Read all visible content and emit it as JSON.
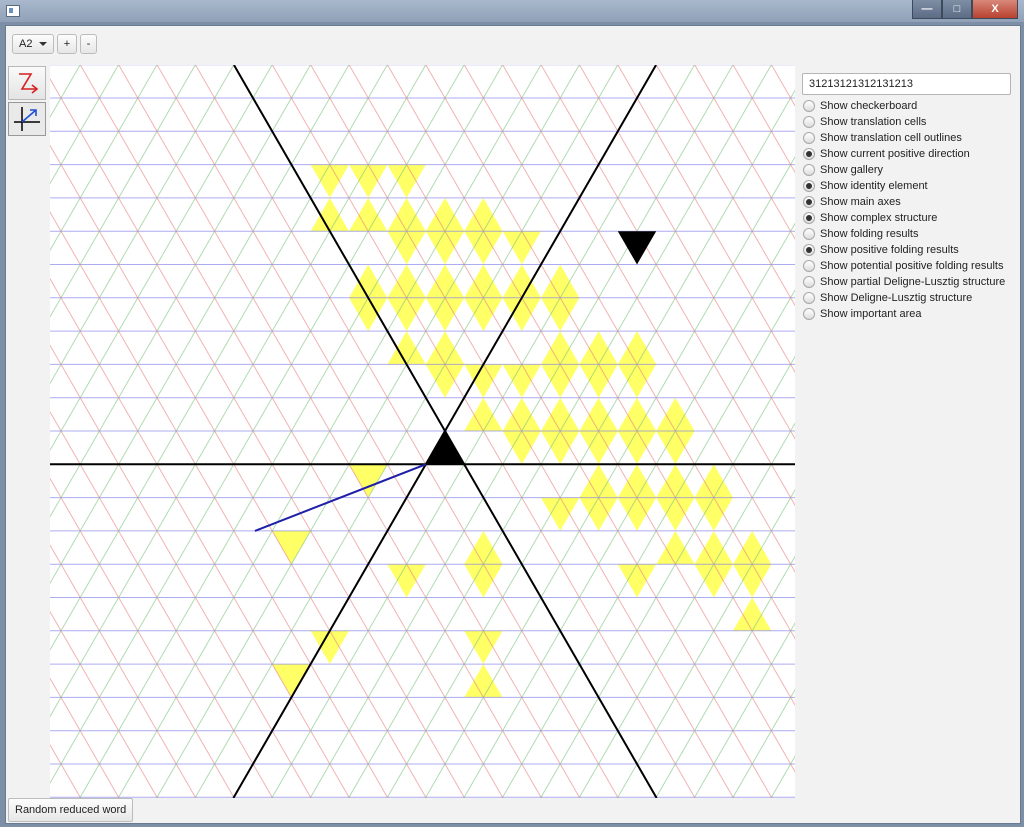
{
  "window": {
    "minimize_label": "—",
    "maximize_label": "□",
    "close_label": "X"
  },
  "toolbar": {
    "type_select": {
      "value": "A2",
      "options": [
        "A2"
      ]
    },
    "zoom_in_label": "+",
    "zoom_out_label": "-"
  },
  "tools": [
    {
      "name": "reduce-word-tool-icon",
      "active": false
    },
    {
      "name": "axes-direction-tool-icon",
      "active": true
    }
  ],
  "word_input": {
    "value": "31213121312131213"
  },
  "options": [
    {
      "label": "Show checkerboard",
      "checked": false
    },
    {
      "label": "Show translation cells",
      "checked": false
    },
    {
      "label": "Show translation cell outlines",
      "checked": false
    },
    {
      "label": "Show current positive direction",
      "checked": true
    },
    {
      "label": "Show gallery",
      "checked": false
    },
    {
      "label": "Show identity element",
      "checked": true
    },
    {
      "label": "Show main axes",
      "checked": true
    },
    {
      "label": "Show complex structure",
      "checked": true
    },
    {
      "label": "Show folding results",
      "checked": false
    },
    {
      "label": "Show positive folding results",
      "checked": true
    },
    {
      "label": "Show potential positive folding results",
      "checked": false
    },
    {
      "label": "Show partial Deligne-Lusztig structure",
      "checked": false
    },
    {
      "label": "Show Deligne-Lusztig structure",
      "checked": false
    },
    {
      "label": "Show important area",
      "checked": false
    }
  ],
  "random_button_label": "Random reduced word",
  "colors": {
    "line_family_1": "#e88080",
    "line_family_2": "#8080e8",
    "line_family_3": "#7fc27f",
    "folding_fill": "#ffff66",
    "identity_fill": "#000000",
    "axis": "#000000",
    "direction": "#1f1fa8"
  },
  "canvas": {
    "yellow_cells": [
      [
        2,
        3,
        2
      ],
      [
        2,
        6,
        1
      ],
      [
        2,
        4,
        1
      ],
      [
        2,
        7,
        2
      ],
      [
        -6,
        -8,
        1
      ],
      [
        -6,
        -7,
        2
      ],
      [
        -4,
        -7,
        2
      ],
      [
        -4,
        -5,
        2
      ],
      [
        -4,
        -8,
        1
      ],
      [
        -4,
        -4,
        1
      ],
      [
        -2,
        -7,
        2
      ],
      [
        -2,
        -5,
        2
      ],
      [
        -2,
        -3,
        2
      ],
      [
        -2,
        -8,
        1
      ],
      [
        -2,
        -6,
        1
      ],
      [
        -2,
        -4,
        1
      ],
      [
        0,
        -7,
        2
      ],
      [
        0,
        -5,
        2
      ],
      [
        0,
        -3,
        2
      ],
      [
        0,
        -6,
        1
      ],
      [
        0,
        -4,
        1
      ],
      [
        0,
        -2,
        1
      ],
      [
        2,
        -7,
        2
      ],
      [
        2,
        -5,
        2
      ],
      [
        2,
        -1,
        2
      ],
      [
        2,
        -6,
        1
      ],
      [
        2,
        -4,
        1
      ],
      [
        2,
        -2,
        1
      ],
      [
        4,
        -5,
        2
      ],
      [
        4,
        -1,
        2
      ],
      [
        4,
        -6,
        1
      ],
      [
        4,
        -4,
        1
      ],
      [
        4,
        -2,
        1
      ],
      [
        4,
        0,
        1
      ],
      [
        6,
        -5,
        2
      ],
      [
        6,
        -3,
        2
      ],
      [
        6,
        -1,
        2
      ],
      [
        6,
        -4,
        1
      ],
      [
        6,
        -2,
        1
      ],
      [
        6,
        0,
        1
      ],
      [
        6,
        2,
        1
      ],
      [
        8,
        -3,
        2
      ],
      [
        8,
        -1,
        2
      ],
      [
        8,
        1,
        2
      ],
      [
        8,
        -2,
        1
      ],
      [
        8,
        0,
        1
      ],
      [
        8,
        2,
        1
      ],
      [
        10,
        -3,
        2
      ],
      [
        10,
        -1,
        2
      ],
      [
        10,
        1,
        2
      ],
      [
        10,
        -2,
        1
      ],
      [
        10,
        0,
        1
      ],
      [
        10,
        2,
        1
      ],
      [
        10,
        4,
        1
      ],
      [
        12,
        -1,
        2
      ],
      [
        12,
        1,
        2
      ],
      [
        12,
        3,
        2
      ],
      [
        12,
        0,
        1
      ],
      [
        12,
        2,
        1
      ],
      [
        14,
        1,
        2
      ],
      [
        14,
        3,
        2
      ],
      [
        14,
        2,
        1
      ],
      [
        14,
        4,
        1
      ],
      [
        16,
        3,
        2
      ],
      [
        16,
        5,
        2
      ],
      [
        16,
        4,
        1
      ],
      [
        -4,
        1,
        1
      ],
      [
        -2,
        4,
        1
      ],
      [
        -6,
        6,
        1
      ],
      [
        -8,
        3,
        1
      ],
      [
        -8,
        7,
        1
      ]
    ],
    "identity_cell": [
      0,
      0,
      2
    ],
    "marker_cell": [
      10,
      -6,
      1
    ],
    "direction_end_cell": [
      -6,
      3
    ]
  }
}
